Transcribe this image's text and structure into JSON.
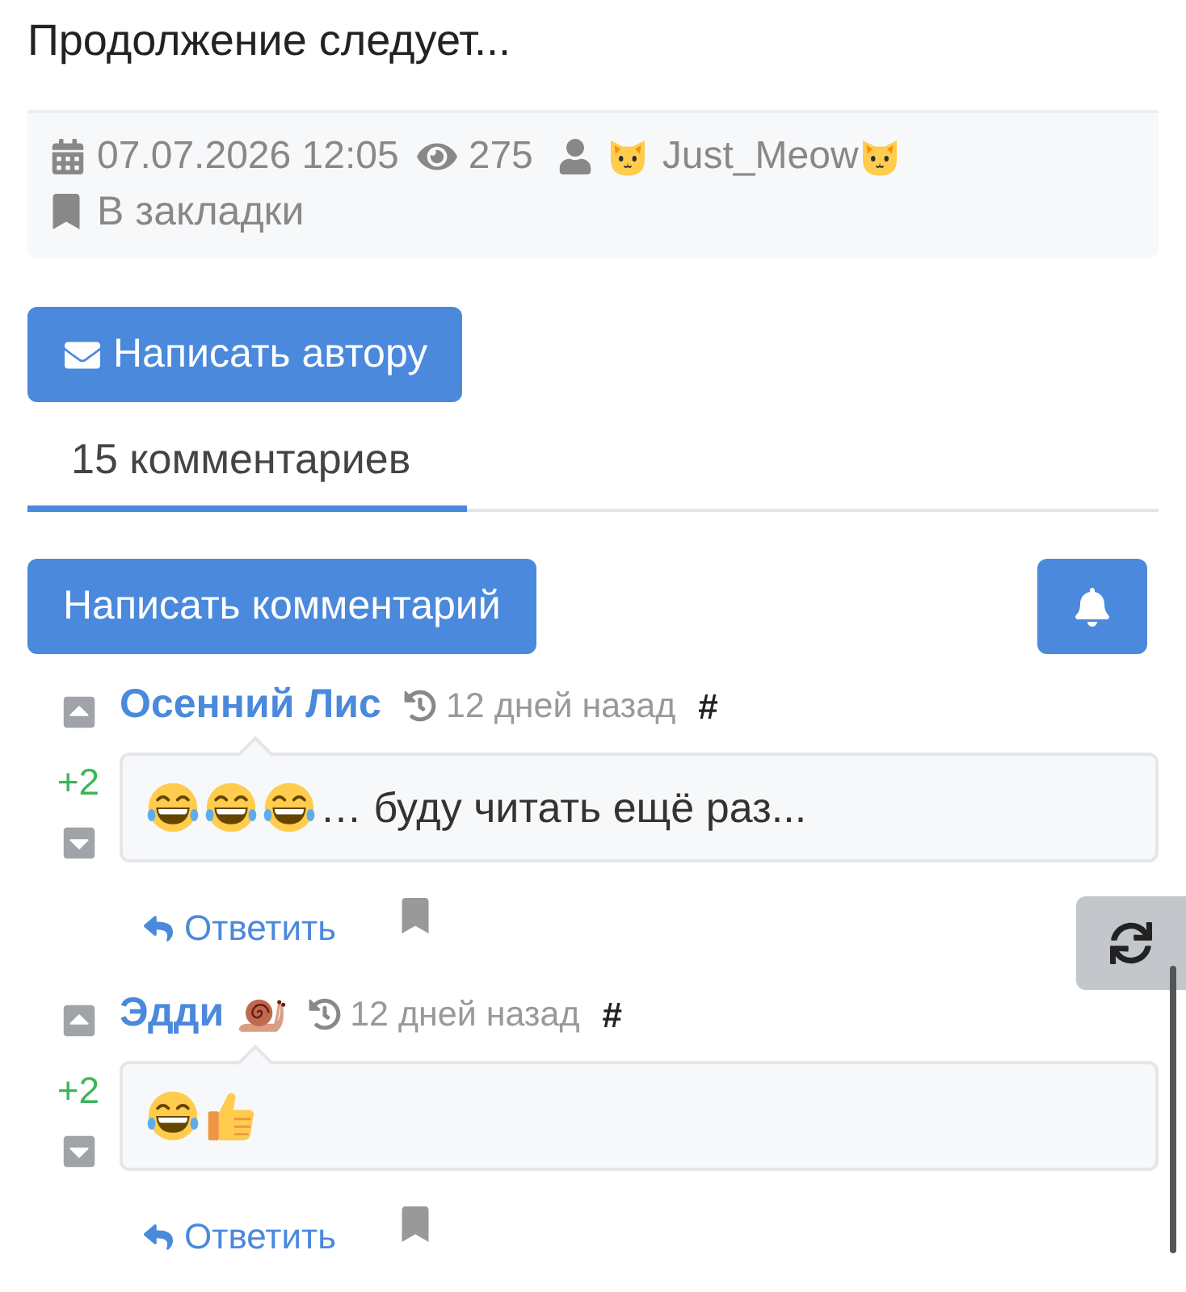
{
  "continuation_text": "Продолжение следует...",
  "post_meta": {
    "date": "07.07.2026 12:05",
    "views": "275",
    "author": {
      "emoji_before": [
        {
          "kind": "cat"
        }
      ],
      "name": "Just_Meow",
      "emoji_after": [
        {
          "kind": "cat"
        }
      ]
    },
    "bookmark_label": "В закладки"
  },
  "write_author_button": "Написать автору",
  "tabs": [
    {
      "label": "15 комментариев",
      "selected": true
    }
  ],
  "write_comment_button": "Написать комментарий",
  "comments": [
    {
      "author": "Осенний Лис",
      "time": "12 дней назад",
      "anchor": "#",
      "score": "+2",
      "emojis": [
        {
          "kind": "laughing"
        },
        {
          "kind": "laughing"
        },
        {
          "kind": "laughing"
        }
      ],
      "text": "… буду читать ещё раз...",
      "reply_label": "Ответить"
    },
    {
      "author": "Эдди",
      "author_emoji": [
        {
          "kind": "snail"
        }
      ],
      "time": "12 дней назад",
      "anchor": "#",
      "score": "+2",
      "emojis": [
        {
          "kind": "laughing"
        },
        {
          "kind": "thumbs_up"
        }
      ],
      "reply_label": "Ответить"
    }
  ]
}
